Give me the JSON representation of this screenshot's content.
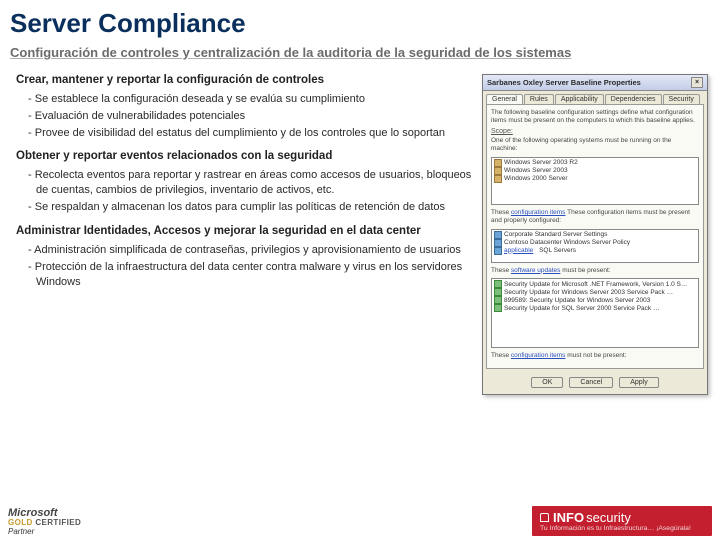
{
  "title": "Server Compliance",
  "subtitle": "Configuración de controles y centralización de la auditoria de la seguridad de los sistemas",
  "sections": [
    {
      "heading": "Crear, mantener y reportar la configuración de controles",
      "items": [
        "Se establece la configuración deseada y se evalúa su cumplimiento",
        "Evaluación de vulnerabilidades potenciales",
        "Provee de visibilidad del estatus del cumplimiento y de los controles que lo soportan"
      ]
    },
    {
      "heading": "Obtener y reportar eventos relacionados con la seguridad",
      "items": [
        "Recolecta eventos para reportar y rastrear en áreas como accesos de usuarios, bloqueos de cuentas, cambios de privilegios, inventario de activos, etc.",
        "Se respaldan y almacenan los datos para cumplir las políticas de retención de datos"
      ]
    },
    {
      "heading": "Administrar Identidades, Accesos y mejorar la seguridad en el data center",
      "items": [
        "Administración simplificada de contraseñas, privilegios y aprovisionamiento de usuarios",
        "Protección de la infraestructura del data center contra malware y virus en los servidores Windows"
      ]
    }
  ],
  "dialog": {
    "title": "Sarbanes Oxley Server Baseline Properties",
    "tabs": [
      "General",
      "Rules",
      "Applicability",
      "Dependencies",
      "Security"
    ],
    "desc": "The following baseline configuration settings define what configuration items must be present on the computers to which this baseline applies.",
    "scope_label": "Scope:",
    "scope_item": "One of the following operating systems must be running on the machine:",
    "os_items": [
      "Windows Server 2003 R2",
      "Windows Server 2003",
      "Windows 2000 Server"
    ],
    "part2_label": "These configuration items must be present and properly configured:",
    "cfg_items": [
      "Corporate Standard Server Settings",
      "Contoso Datacenter Windows Server Policy",
      "SQL Servers"
    ],
    "applic_label": "applicable",
    "part3_label": "These software updates must be present:",
    "upd_items": [
      "Security Update for Microsoft .NET Framework, Version 1.0 S…",
      "Security Update for Windows Server 2003 Service Pack …",
      "899589: Security Update for Windows Server 2003",
      "Security Update for SQL Server 2000 Service Pack …"
    ],
    "part4_label": "configuration items",
    "buttons": {
      "ok": "OK",
      "cancel": "Cancel",
      "apply": "Apply"
    }
  },
  "footer": {
    "ms_brand": "Microsoft",
    "ms_gold": "GOLD CERTIFIED",
    "ms_partner": "Partner",
    "info_brand": "INFOsecurity",
    "info_tag": "Tu Información es tu Infraestructura… ¡Asegúrala!"
  }
}
